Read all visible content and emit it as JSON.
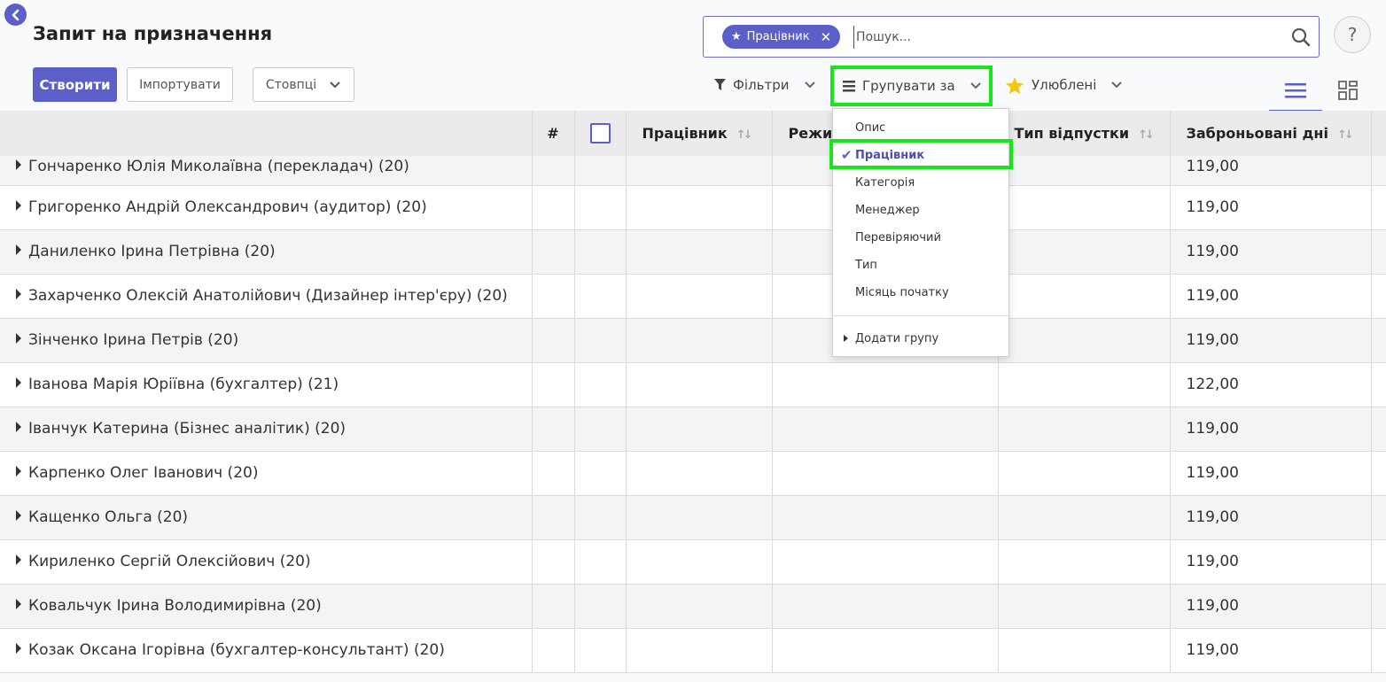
{
  "header": {
    "title": "Запит на призначення",
    "facet_label": "Працівник",
    "search_placeholder": "Пошук...",
    "help_label": "?"
  },
  "buttons": {
    "create": "Створити",
    "import": "Імпортувати",
    "columns": "Стовпці"
  },
  "toolbar": {
    "filters": "Фільтри",
    "groupby": "Групувати за",
    "favorites": "Улюблені"
  },
  "colors": {
    "accent": "#5b5fc7",
    "highlight": "#19e619",
    "star": "#f5c518"
  },
  "table": {
    "columns": [
      "#",
      "",
      "Працівник",
      "Режим",
      "Тип відпустки",
      "Заброньовані дні"
    ],
    "rows": [
      {
        "name": "Гончаренко Юлія Миколаївна (перекладач) (20)",
        "days": "119,00"
      },
      {
        "name": "Григоренко Андрій Олександрович (аудитор) (20)",
        "days": "119,00"
      },
      {
        "name": "Даниленко Ірина Петрівна (20)",
        "days": "119,00"
      },
      {
        "name": "Захарченко Олексій Анатолійович (Дизайнер інтер'єру) (20)",
        "days": "119,00"
      },
      {
        "name": "Зінченко Ірина Петрів (20)",
        "days": "119,00"
      },
      {
        "name": "Іванова Марія Юріївна (бухгалтер) (21)",
        "days": "122,00"
      },
      {
        "name": "Іванчук Катерина (Бізнес аналітик) (20)",
        "days": "119,00"
      },
      {
        "name": "Карпенко Олег Іванович (20)",
        "days": "119,00"
      },
      {
        "name": "Кащенко Ольга (20)",
        "days": "119,00"
      },
      {
        "name": "Кириленко Сергій Олексійович (20)",
        "days": "119,00"
      },
      {
        "name": "Ковальчук Ірина Володимирівна (20)",
        "days": "119,00"
      },
      {
        "name": "Козак Оксана Ігорівна (бухгалтер-консультант) (20)",
        "days": "119,00"
      }
    ]
  },
  "groupby_menu": {
    "items": [
      "Опис",
      "Працівник",
      "Категорія",
      "Менеджер",
      "Перевіряючий",
      "Тип",
      "Місяць початку"
    ],
    "selected": "Працівник",
    "add_group": "Додати групу"
  }
}
